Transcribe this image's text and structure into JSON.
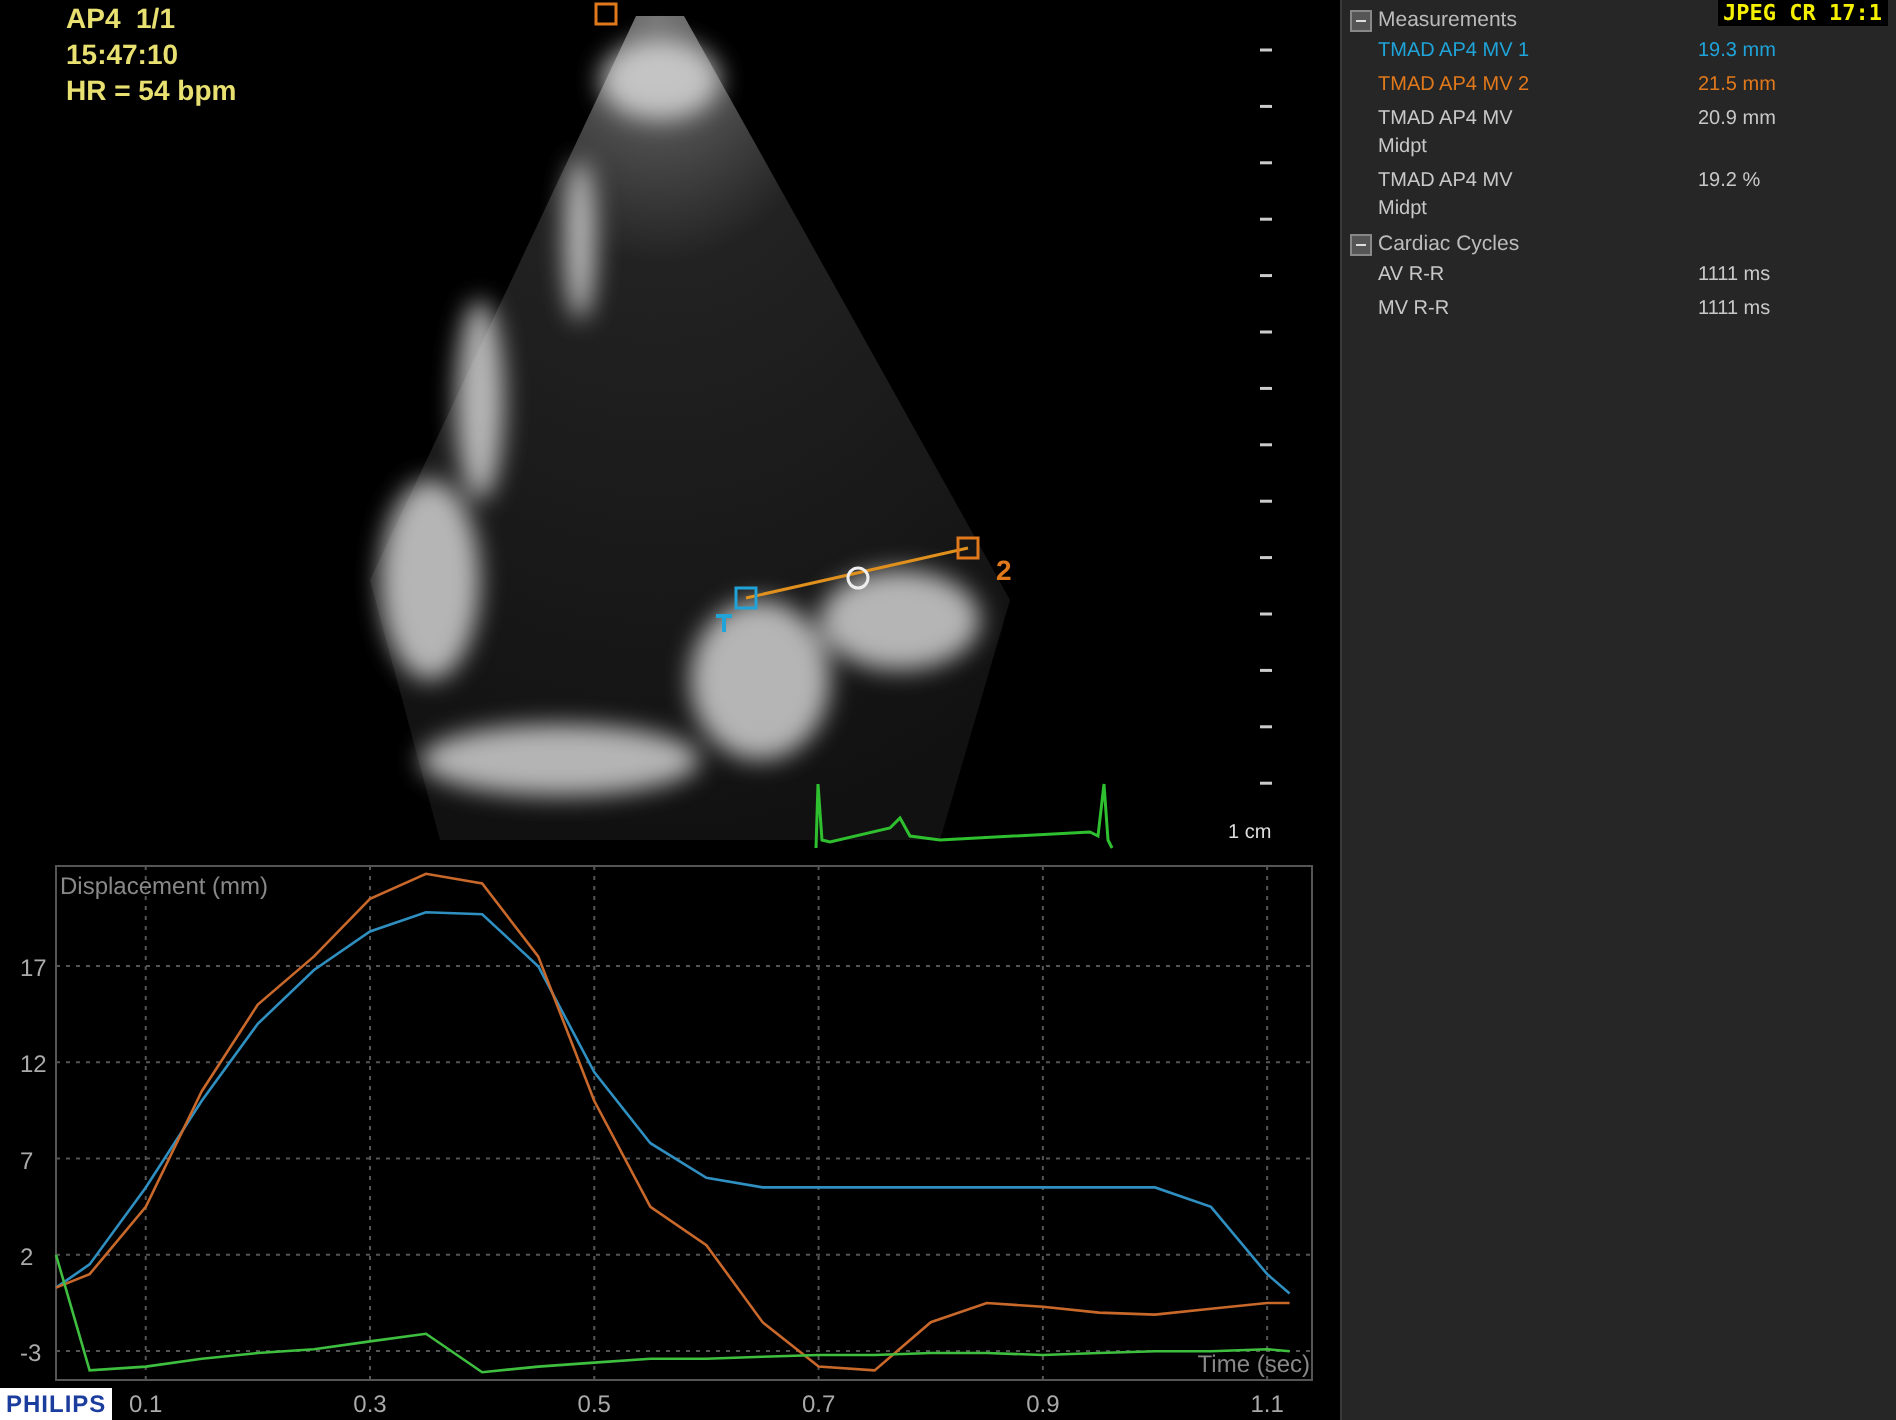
{
  "image_info": {
    "view": "AP4  1/1",
    "time": "15:47:10",
    "heart_rate": "HR = 54 bpm",
    "caliper_label": "2",
    "scale_label": "1 cm"
  },
  "compression": "JPEG CR 17:1",
  "logo": "PHILIPS",
  "panel": {
    "groups": [
      {
        "title": "Measurements",
        "expanded": true,
        "items": [
          {
            "label": "TMAD AP4 MV 1",
            "value": "19.3 mm",
            "color": "#1fa3d8"
          },
          {
            "label": "TMAD AP4 MV 2",
            "value": "21.5 mm",
            "color": "#e0781c"
          },
          {
            "label": "TMAD AP4 MV Midpt",
            "value": "20.9 mm",
            "color": "#c8c8c8"
          },
          {
            "label": "TMAD AP4 MV Midpt",
            "value": "19.2 %",
            "color": "#c8c8c8"
          }
        ]
      },
      {
        "title": "Cardiac Cycles",
        "expanded": true,
        "items": [
          {
            "label": "AV R-R",
            "value": "1111 ms",
            "color": "#c8c8c8"
          },
          {
            "label": "MV R-R",
            "value": "1111 ms",
            "color": "#c8c8c8"
          }
        ]
      }
    ]
  },
  "chart": {
    "chart_data": {
      "type": "line",
      "ylabel": "Displacement (mm)",
      "xlabel": "Time (sec)",
      "xlim": [
        0.02,
        1.14
      ],
      "ylim": [
        -4.5,
        22.2
      ],
      "grid": true,
      "xticks": [
        0.1,
        0.3,
        0.5,
        0.7,
        0.9,
        1.1
      ],
      "yticks": [
        -3,
        2,
        7,
        12,
        17
      ],
      "x": [
        0.02,
        0.05,
        0.1,
        0.15,
        0.2,
        0.25,
        0.3,
        0.35,
        0.4,
        0.45,
        0.5,
        0.55,
        0.6,
        0.65,
        0.7,
        0.75,
        0.8,
        0.85,
        0.9,
        0.95,
        1.0,
        1.05,
        1.1,
        1.12
      ],
      "series": [
        {
          "color": "#2f8fc0",
          "values": [
            0.3,
            1.5,
            5.5,
            10,
            14,
            16.8,
            18.8,
            19.8,
            19.7,
            17,
            11.5,
            7.8,
            6,
            5.5,
            5.5,
            5.5,
            5.5,
            5.5,
            5.5,
            5.5,
            5.5,
            4.5,
            1,
            0
          ]
        },
        {
          "color": "#c8682a",
          "values": [
            0.3,
            1,
            4.5,
            10.5,
            15,
            17.5,
            20.5,
            21.8,
            21.3,
            17.5,
            10,
            4.5,
            2.5,
            -1.5,
            -3.8,
            -4,
            -1.5,
            -0.5,
            -0.7,
            -1,
            -1.1,
            -0.8,
            -0.5,
            -0.5
          ]
        },
        {
          "color": "#3fbf3f",
          "values": [
            2,
            -4,
            -3.8,
            -3.4,
            -3.1,
            -2.9,
            -2.5,
            -2.1,
            -4.1,
            -3.8,
            -3.6,
            -3.4,
            -3.4,
            -3.3,
            -3.2,
            -3.2,
            -3.1,
            -3.1,
            -3.2,
            -3.1,
            -3,
            -3,
            -2.9,
            -3
          ]
        }
      ]
    }
  }
}
